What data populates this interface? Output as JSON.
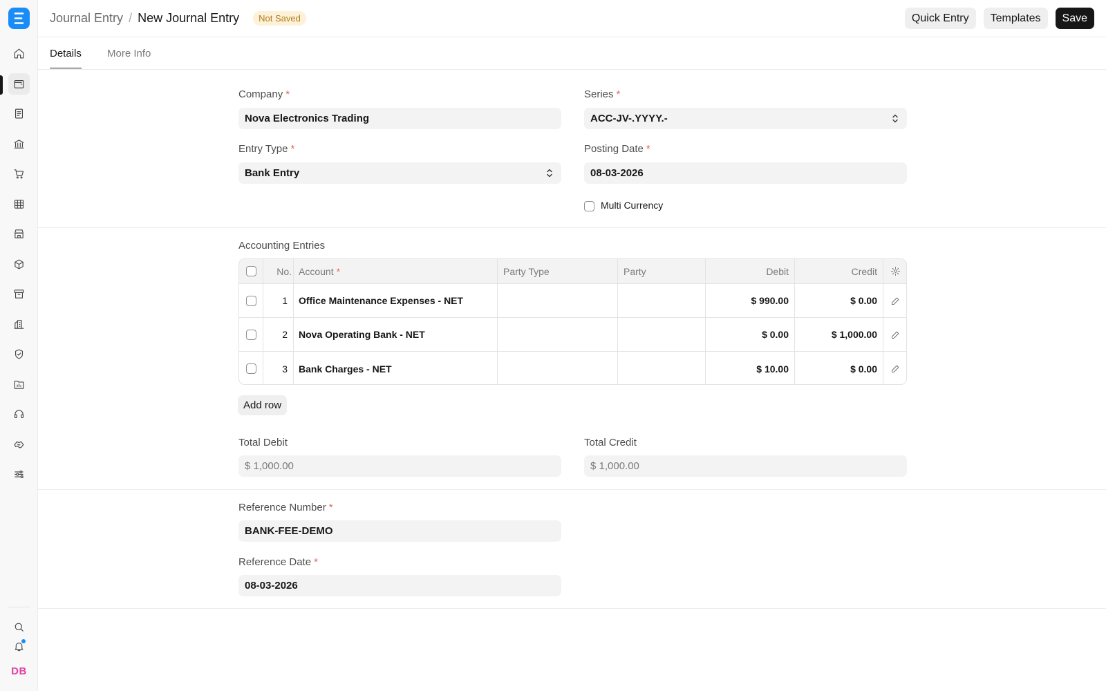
{
  "sidebar": {
    "logo_letter": "E",
    "icons": [
      "home-icon",
      "wallet-icon",
      "document-icon",
      "bank-icon",
      "cart-icon",
      "table-icon",
      "store-icon",
      "package-icon",
      "archive-icon",
      "building-icon",
      "shield-icon",
      "folder-chart-icon",
      "headset-icon",
      "handshake-icon",
      "sliders-icon"
    ],
    "bottom_icons": [
      "search-icon",
      "bell-icon"
    ],
    "avatar": "DB"
  },
  "header": {
    "parent": "Journal Entry",
    "separator": "/",
    "title": "New Journal Entry",
    "badge": "Not Saved",
    "actions": {
      "quick_entry": "Quick Entry",
      "templates": "Templates",
      "save": "Save"
    }
  },
  "tabs": [
    {
      "label": "Details"
    },
    {
      "label": "More Info"
    }
  ],
  "form": {
    "company": {
      "label": "Company",
      "value": "Nova Electronics Trading"
    },
    "series": {
      "label": "Series",
      "value": "ACC-JV-.YYYY.-"
    },
    "entry_type": {
      "label": "Entry Type",
      "value": "Bank Entry"
    },
    "posting_date": {
      "label": "Posting Date",
      "value": "08-03-2026"
    },
    "multi_currency": {
      "label": "Multi Currency",
      "checked": false
    },
    "required_mark": "*"
  },
  "accounting": {
    "title": "Accounting Entries",
    "columns": {
      "no": "No.",
      "account": "Account",
      "party_type": "Party Type",
      "party": "Party",
      "debit": "Debit",
      "credit": "Credit"
    },
    "rows": [
      {
        "no": "1",
        "account": "Office Maintenance Expenses - NET",
        "party_type": "",
        "party": "",
        "debit": "$ 990.00",
        "credit": "$ 0.00"
      },
      {
        "no": "2",
        "account": "Nova Operating Bank - NET",
        "party_type": "",
        "party": "",
        "debit": "$ 0.00",
        "credit": "$ 1,000.00"
      },
      {
        "no": "3",
        "account": "Bank Charges - NET",
        "party_type": "",
        "party": "",
        "debit": "$ 10.00",
        "credit": "$ 0.00"
      }
    ],
    "add_row": "Add row"
  },
  "totals": {
    "total_debit": {
      "label": "Total Debit",
      "value": "$ 1,000.00"
    },
    "total_credit": {
      "label": "Total Credit",
      "value": "$ 1,000.00"
    }
  },
  "reference": {
    "number": {
      "label": "Reference Number",
      "value": "BANK-FEE-DEMO"
    },
    "date": {
      "label": "Reference Date",
      "value": "08-03-2026"
    }
  },
  "colors": {
    "brand": "#1a8cf7",
    "badge_text": "#b07b20",
    "badge_bg": "#fdf2d8",
    "required": "#e26a5e",
    "avatar": "#e040a0"
  }
}
